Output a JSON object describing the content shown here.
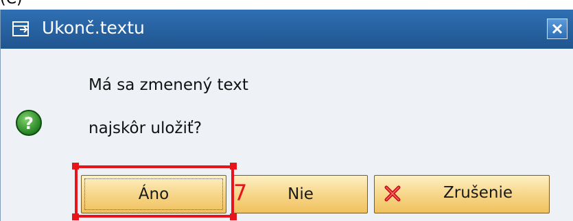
{
  "caption": {
    "partial_text": "(C)"
  },
  "dialog": {
    "title": "Ukonč.textu",
    "message_line1": "Má sa zmenený text",
    "message_line2": "najskôr uložiť?",
    "question_icon": "question-icon",
    "title_icon": "dialog-icon",
    "close_icon": "close-icon"
  },
  "buttons": {
    "yes_label": "Áno",
    "no_label": "Nie",
    "cancel_label": "Zrušenie",
    "cancel_icon": "cancel-x-icon"
  },
  "annotation": {
    "step_number": "7",
    "highlight_color": "#e8141c"
  },
  "colors": {
    "titlebar": "#2a64a4",
    "dialog_background": "#eef2f7",
    "button_gradient_top": "#fdf0c2",
    "button_gradient_bottom": "#f0c25e"
  }
}
